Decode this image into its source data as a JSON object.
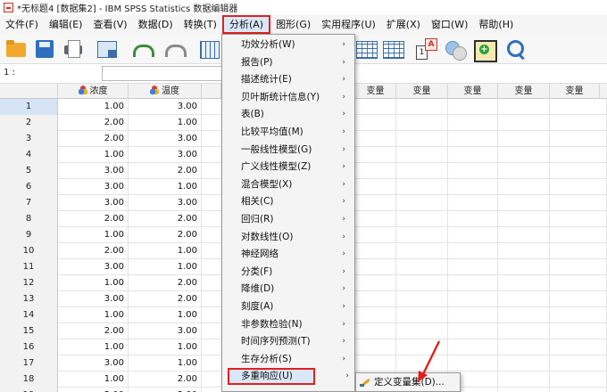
{
  "window": {
    "title": "*无标题4 [数据集2] - IBM SPSS Statistics 数据编辑器"
  },
  "menubar": {
    "items": [
      {
        "label": "文件(F)"
      },
      {
        "label": "编辑(E)"
      },
      {
        "label": "查看(V)"
      },
      {
        "label": "数据(D)"
      },
      {
        "label": "转换(T)"
      },
      {
        "label": "分析(A)",
        "active": true
      },
      {
        "label": "图形(G)"
      },
      {
        "label": "实用程序(U)"
      },
      {
        "label": "扩展(X)"
      },
      {
        "label": "窗口(W)"
      },
      {
        "label": "帮助(H)"
      }
    ]
  },
  "toolbar": {
    "icons": [
      "folder-icon",
      "save-icon",
      "print-icon",
      "dialog-recall-icon",
      "undo-icon",
      "redo-icon",
      "goto-case-icon",
      "split-file-icon",
      "select-cases-icon",
      "weight-cases-icon",
      "value-labels-icon",
      "use-variable-sets-icon",
      "search-icon"
    ]
  },
  "cellref": {
    "label": "1 :",
    "value": ""
  },
  "grid": {
    "columns": [
      {
        "label": "浓度",
        "icon": "nominal-variable-icon"
      },
      {
        "label": "温度",
        "icon": "nominal-variable-icon"
      },
      {
        "label": "变量"
      },
      {
        "label": "变量"
      },
      {
        "label": "变量"
      },
      {
        "label": "变量"
      },
      {
        "label": "变量"
      },
      {
        "label": "变量"
      }
    ],
    "rows": [
      {
        "n": "1",
        "a": "1.00",
        "b": "3.00"
      },
      {
        "n": "2",
        "a": "2.00",
        "b": "1.00"
      },
      {
        "n": "3",
        "a": "2.00",
        "b": "3.00"
      },
      {
        "n": "4",
        "a": "1.00",
        "b": "3.00"
      },
      {
        "n": "5",
        "a": "3.00",
        "b": "2.00"
      },
      {
        "n": "6",
        "a": "3.00",
        "b": "1.00"
      },
      {
        "n": "7",
        "a": "3.00",
        "b": "3.00"
      },
      {
        "n": "8",
        "a": "2.00",
        "b": "2.00"
      },
      {
        "n": "9",
        "a": "1.00",
        "b": "2.00"
      },
      {
        "n": "10",
        "a": "2.00",
        "b": "1.00"
      },
      {
        "n": "11",
        "a": "3.00",
        "b": "1.00"
      },
      {
        "n": "12",
        "a": "1.00",
        "b": "2.00"
      },
      {
        "n": "13",
        "a": "3.00",
        "b": "2.00"
      },
      {
        "n": "14",
        "a": "1.00",
        "b": "1.00"
      },
      {
        "n": "15",
        "a": "2.00",
        "b": "3.00"
      },
      {
        "n": "16",
        "a": "1.00",
        "b": "1.00"
      },
      {
        "n": "17",
        "a": "3.00",
        "b": "1.00"
      },
      {
        "n": "18",
        "a": "1.00",
        "b": "2.00"
      },
      {
        "n": "19",
        "a": "2.00",
        "b": "2.00"
      }
    ]
  },
  "analyze_menu": {
    "items": [
      {
        "label": "功效分析(W)",
        "submenu": true
      },
      {
        "label": "报告(P)",
        "submenu": true
      },
      {
        "label": "描述统计(E)",
        "submenu": true
      },
      {
        "label": "贝叶斯统计信息(Y)",
        "submenu": true
      },
      {
        "label": "表(B)",
        "submenu": true
      },
      {
        "label": "比较平均值(M)",
        "submenu": true
      },
      {
        "label": "一般线性模型(G)",
        "submenu": true
      },
      {
        "label": "广义线性模型(Z)",
        "submenu": true
      },
      {
        "label": "混合模型(X)",
        "submenu": true
      },
      {
        "label": "相关(C)",
        "submenu": true
      },
      {
        "label": "回归(R)",
        "submenu": true
      },
      {
        "label": "对数线性(O)",
        "submenu": true
      },
      {
        "label": "神经网络",
        "submenu": true
      },
      {
        "label": "分类(F)",
        "submenu": true
      },
      {
        "label": "降维(D)",
        "submenu": true
      },
      {
        "label": "刻度(A)",
        "submenu": true
      },
      {
        "label": "非参数检验(N)",
        "submenu": true
      },
      {
        "label": "时间序列预测(T)",
        "submenu": true
      },
      {
        "label": "生存分析(S)",
        "submenu": true
      },
      {
        "label": "多重响应(U)",
        "submenu": true,
        "highlighted": true
      }
    ],
    "arrow": "›"
  },
  "multiple_response_submenu": {
    "items": [
      {
        "label": "定义变量集(D)...",
        "icon": "define-sets-icon"
      }
    ]
  },
  "colors": {
    "highlight_border": "#e02020",
    "highlight_fill": "#d9e7f7",
    "menu_bg": "#f4f4f4"
  }
}
